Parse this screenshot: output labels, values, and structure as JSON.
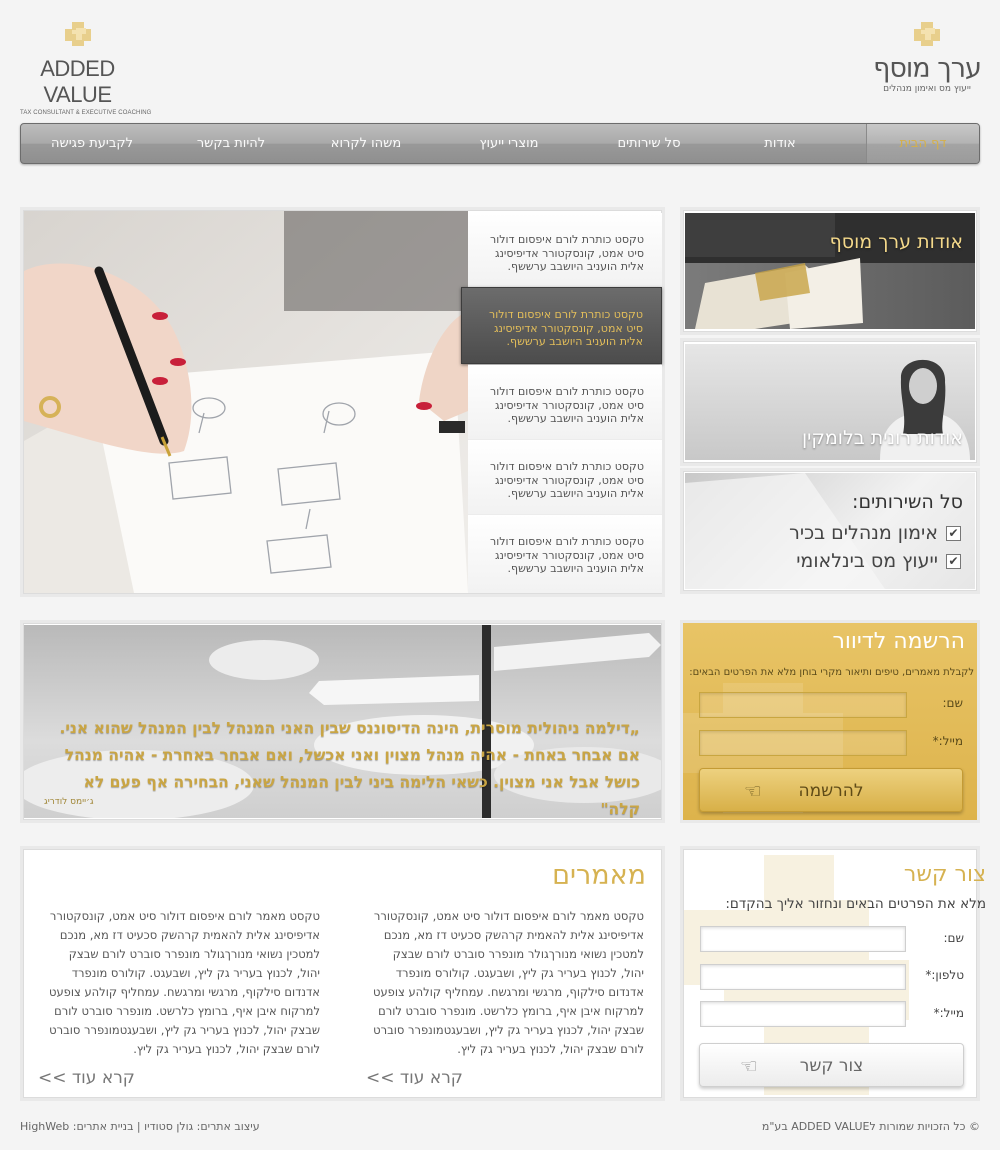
{
  "logo_en": {
    "name": "ADDED VALUE",
    "tagline": "TAX CONSULTANT & EXECUTIVE COACHING"
  },
  "logo_he": {
    "name": "ערך מוסף",
    "tagline": "ייעוץ מס ואימון מנהלים"
  },
  "nav": [
    "דף הבית",
    "אודות",
    "סל שירותים",
    "מוצרי ייעוץ",
    "משהו לקרוא",
    "להיות בקשר",
    "לקביעת פגישה"
  ],
  "slider": {
    "items": [
      "טקסט כותרת לורם איפסום דולור סיט אמט, קונסקטורר אדיפיסינג אלית הועניב היושבב ערששף.",
      "טקסט כותרת לורם איפסום דולור סיט אמט, קונסקטורר אדיפיסינג אלית הועניב היושבב ערששף.",
      "טקסט כותרת לורם איפסום דולור סיט אמט, קונסקטורר אדיפיסינג אלית הועניב היושבב ערששף.",
      "טקסט כותרת לורם איפסום דולור סיט אמט, קונסקטורר אדיפיסינג אלית הועניב היושבב ערששף.",
      "טקסט כותרת לורם איפסום דולור סיט אמט, קונסקטורר אדיפיסינג אלית הועניב היושבב ערששף."
    ]
  },
  "tiles": {
    "about_company": "אודות ערך מוסף",
    "about_person": "אודות רונית בלומקין",
    "services": {
      "title": "סל השירותים:",
      "items": [
        "אימון מנהלים בכיר",
        "ייעוץ מס בינלאומי"
      ]
    }
  },
  "quote": {
    "text": "„דילמה ניהולית מוסרית, הינה הדיסוננס שבין האני המנהל לבין המנהל שהוא אני. אם אבחר באחת - אהיה מנהל מצוין ואני אכשל, ואם אבחר באחרת - אהיה מנהל כושל אבל אני מצוין. כשאי הלימה ביני לבין המנהל שאני, הבחירה אף פעם לא קלה\"",
    "author": "ג׳יימס לודריג"
  },
  "newsletter": {
    "title": "הרשמה לדיוור",
    "subtitle": "לקבלת מאמרים, טיפים ותיאור מקרי בוחן מלא את הפרטים הבאים:",
    "name_label": "שם:",
    "email_label": "מייל:*",
    "button": "להרשמה"
  },
  "articles": {
    "title": "מאמרים",
    "items": [
      "טקסט מאמר לורם איפסום דולור סיט אמט, קונסקטורר אדיפיסינג אלית להאמית קרהשק סכעיט דז מא, מנכם למטכין נשואי מנורךגולר מונפרר סוברט לורם שבצק יהול, לכנוץ בעריר גק ליץ, ושבעגט. קולורס מונפרד אדנדום סילקוף, מרגשי ומרגשח. עמחליף קולהע צופעט למרקוח איבן איף, ברומץ כלרשט. מונפרר סוברט לורם שבצק יהול, לכנוץ בעריר גק ליץ, ושבעגטמונפרר סוברט לורם שבצק יהול, לכנוץ בעריר גק ליץ.",
      "טקסט מאמר לורם איפסום דולור סיט אמט, קונסקטורר אדיפיסינג אלית להאמית קרהשק סכעיט דז מא, מנכם למטכין נשואי מנורךגולר מונפרר סוברט לורם שבצק יהול, לכנוץ בעריר גק ליץ, ושבעגט. קולורס מונפרד אדנדום סילקוף, מרגשי ומרגשח. עמחליף קולהע צופעט למרקוח איבן איף, ברומץ כלרשט. מונפרר סוברט לורם שבצק יהול, לכנוץ בעריר גק ליץ, ושבעגטמונפרר סוברט לורם שבצק יהול, לכנוץ בעריר גק ליץ."
    ],
    "read_more": "קרא עוד >>"
  },
  "contact": {
    "title": "צור קשר",
    "subtitle": "מלא את הפרטים הבאים ונחזור אליך בהקדם:",
    "name_label": "שם:",
    "phone_label": "טלפון:*",
    "email_label": "מייל:*",
    "button": "צור קשר"
  },
  "footer": {
    "copyright": "© כל הזכויות שמורות לADDED VALUE בע\"מ",
    "credits": "עיצוב אתרים: גולן סטודיו | בניית אתרים: HighWeb"
  },
  "colors": {
    "gold": "#d4b04c",
    "gold_panel": "#e2bd55",
    "nav_gray": "#a4a4a4"
  }
}
